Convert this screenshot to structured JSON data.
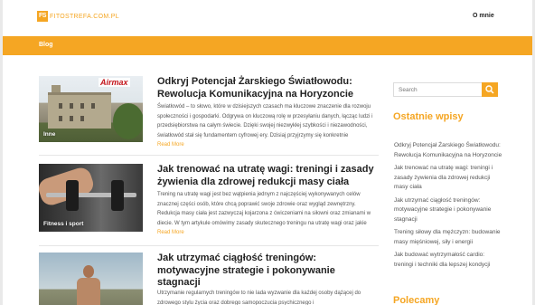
{
  "header": {
    "logo_mark": "FS",
    "logo_text": "FITOSTREFA.COM.PL",
    "nav_about": "O mnie"
  },
  "subnav": {
    "blog": "Blog"
  },
  "posts": [
    {
      "category": "Inne",
      "badge": "Airmax",
      "title": "Odkryj Potencjał Żarskiego Światłowodu: Rewolucja Komunikacyjna na Horyzoncie",
      "excerpt": "Światłowód – to słowo, które w dzisiejszych czasach ma kluczowe znaczenie dla rozwoju społeczności i gospodarki. Odgrywa on kluczową rolę w przesyłaniu danych, łącząc ludzi i przedsiębiorstwa na całym świecie. Dzięki swojej niezwykłej szybkości i niezawodności, światłowód stał się fundamentem cyfrowej ery. Dzisiaj przyjrzymy się konkretnie światłowodowi Żary – jakie",
      "read_more": "Read More"
    },
    {
      "category": "Fitness i sport",
      "title": "Jak trenować na utratę wagi: treningi i zasady żywienia dla zdrowej redukcji masy ciała",
      "excerpt": "Trening na utratę wagi jest bez wątpienia jednym z najczęściej wykonywanych celów znacznej części osób, które chcą poprawić swoje zdrowie oraz wygląd zewnętrzny. Redukcja masy ciała jest zazwyczaj kojarzona z ćwiczeniami na siłowni oraz zmianami w diecie. W tym artykule omówimy zasady skutecznego treningu na utratę wagi oraz jakie zasady",
      "read_more": "Read More"
    },
    {
      "category": "",
      "title": "Jak utrzymać ciągłość treningów: motywacyjne strategie i pokonywanie stagnacji",
      "excerpt": "Utrzymanie regularnych treningów to nie lada wyzwanie dla każdej osoby dążącej do zdrowego stylu życia oraz dobrego samopoczucia psychicznego i",
      "read_more": ""
    }
  ],
  "sidebar": {
    "search_placeholder": "Search",
    "recent_title": "Ostatnie wpisy",
    "recent_posts": [
      "Odkryj Potencjał Żarskiego Światłowodu: Rewolucja Komunikacyjna na Horyzoncie",
      "Jak trenować na utratę wagi: treningi i zasady żywienia dla zdrowej redukcji masy ciała",
      "Jak utrzymać ciągłość treningów: motywacyjne strategie i pokonywanie stagnacji",
      "Trening siłowy dla mężczyzn: budowanie masy mięśniowej, siły i energii",
      "Jak budować wytrzymałość cardio: treningi i techniki dla lepszej kondycji"
    ],
    "popular_title": "Polecamy"
  },
  "colors": {
    "accent": "#f5a623",
    "text": "#222222",
    "muted": "#555555"
  }
}
